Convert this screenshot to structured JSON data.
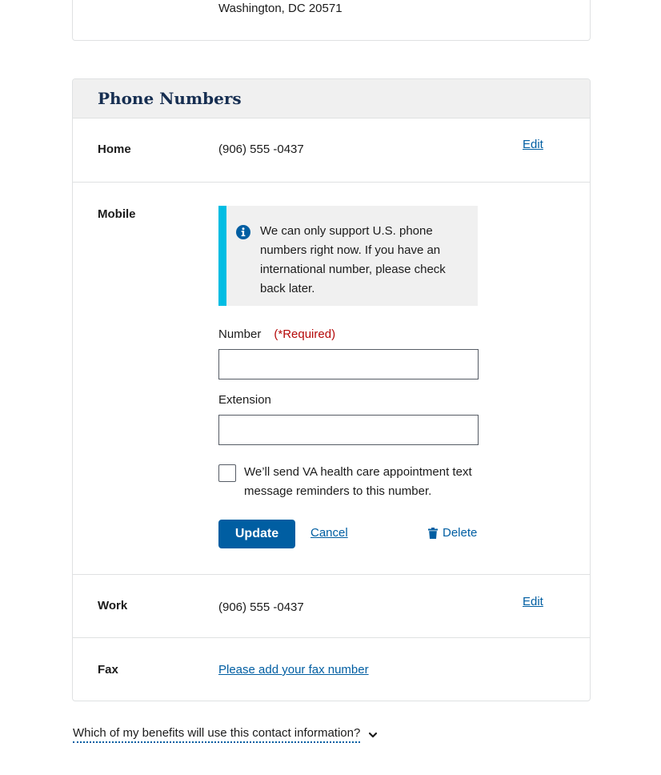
{
  "address": {
    "line": "Washington, DC 20571"
  },
  "phone_section": {
    "title": "Phone Numbers",
    "home": {
      "label": "Home",
      "value": "(906) 555 -0437",
      "edit": "Edit"
    },
    "mobile": {
      "label": "Mobile",
      "alert": "We can only support U.S. phone numbers right now.  If you have an international number, please check back later.",
      "number_label": "Number",
      "required": "(*Required)",
      "number_value": "",
      "extension_label": "Extension",
      "extension_value": "",
      "checkbox_label": "We’ll send VA health care appointment text message reminders to this number.",
      "update": "Update",
      "cancel": "Cancel",
      "delete": "Delete"
    },
    "work": {
      "label": "Work",
      "value": "(906) 555 -0437",
      "edit": "Edit"
    },
    "fax": {
      "label": "Fax",
      "link": "Please add your fax number"
    }
  },
  "benefits_link": "Which of my benefits will use this contact information?",
  "colors": {
    "primary": "#005ea2",
    "alert_border": "#00bde3",
    "required": "#b50909",
    "heading": "#162e51"
  }
}
